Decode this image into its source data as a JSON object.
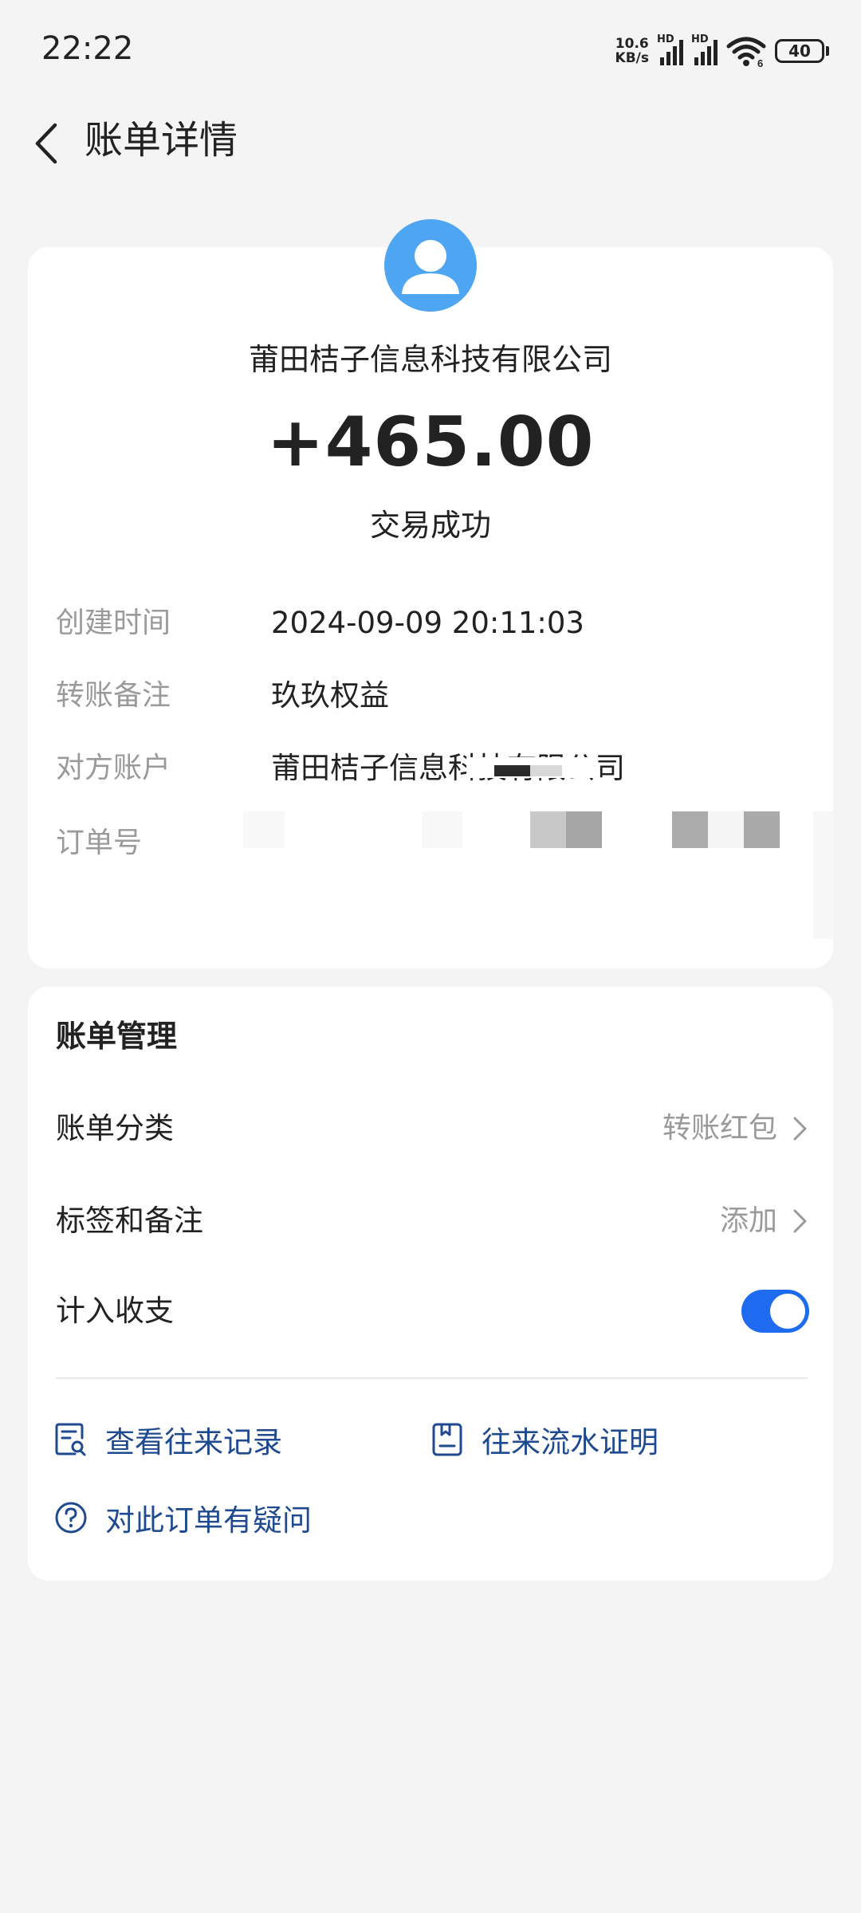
{
  "status_bar": {
    "time": "22:22",
    "net_speed_value": "10.6",
    "net_speed_unit": "KB/s",
    "signal1_label": "HD",
    "signal2_label": "HD",
    "wifi_badge": "6",
    "battery": "40"
  },
  "header": {
    "title": "账单详情",
    "back_icon": "chevron-left-icon"
  },
  "transaction": {
    "avatar_icon": "user-avatar-icon",
    "accent_color": "#4ea6f2",
    "payee_name": "莆田桔子信息科技有限公司",
    "amount": "+465.00",
    "status": "交易成功",
    "details": {
      "created_time_label": "创建时间",
      "created_time": "2024-09-09 20:11:03",
      "remark_label": "转账备注",
      "remark": "玖玖权益",
      "counterparty_label": "对方账户",
      "counterparty": "莆田桔子信息科技有限公司",
      "order_no_label": "订单号"
    }
  },
  "management": {
    "title": "账单管理",
    "category_label": "账单分类",
    "category_value": "转账红包",
    "tags_label": "标签和备注",
    "tags_value": "添加",
    "include_label": "计入收支",
    "include_enabled": true,
    "toggle_color": "#1f6bf0",
    "links": {
      "records": "查看往来记录",
      "statement": "往来流水证明",
      "question": "对此订单有疑问"
    },
    "link_color": "#1f4a8f"
  }
}
